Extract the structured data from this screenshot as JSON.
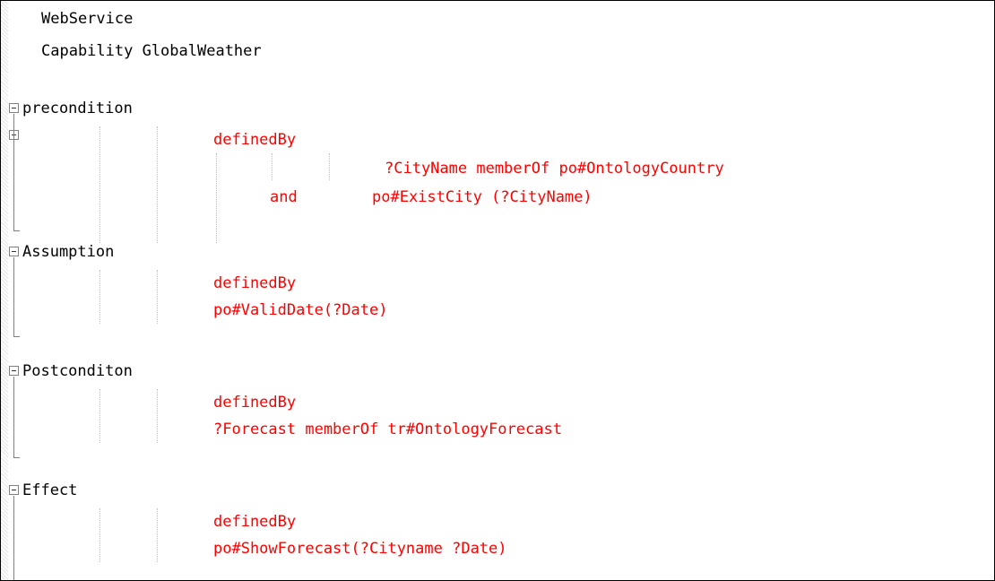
{
  "editor": {
    "lines": {
      "webservice": "WebService",
      "capability": "Capability GlobalWeather",
      "precondition": "precondition",
      "precondition_definedby": "definedBy",
      "precondition_clause1": "?CityName memberOf po#OntologyCountry",
      "precondition_and": "and",
      "precondition_clause2": "po#ExistCity (?CityName)",
      "assumption": "Assumption",
      "assumption_definedby": "definedBy",
      "assumption_clause": "po#ValidDate(?Date)",
      "postcondition": "Postconditon",
      "postcondition_definedby": "definedBy",
      "postcondition_clause": "?Forecast memberOf tr#OntologyForecast",
      "effect": "Effect",
      "effect_definedby": "definedBy",
      "effect_clause": "po#ShowForecast(?Cityname ?Date)"
    },
    "colors": {
      "keyword": "#000000",
      "definition": "#ff0000"
    }
  }
}
